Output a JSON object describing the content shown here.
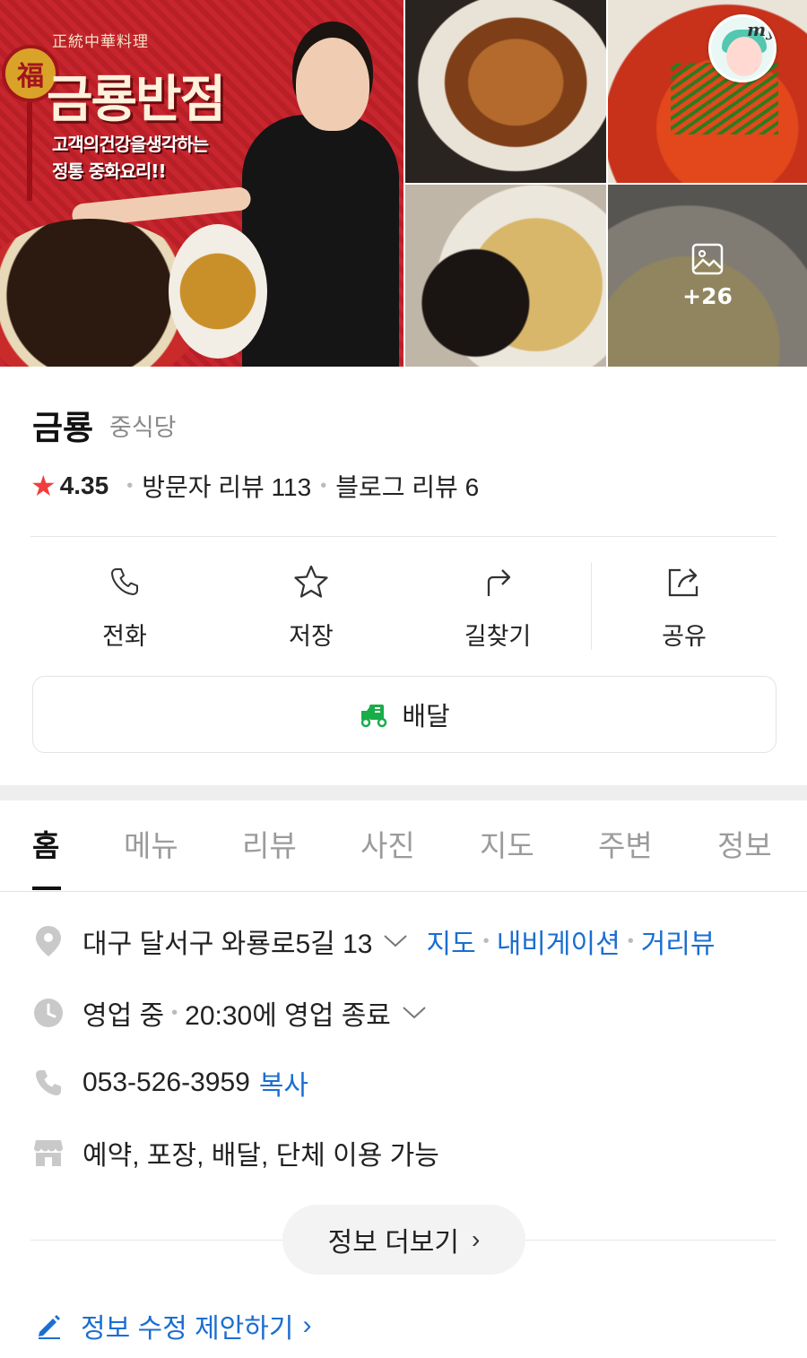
{
  "gallery": {
    "banner_subtitle": "正統中華料理",
    "banner_brand": "금룡반점",
    "banner_slogan_line1": "고객의건강을생각하는",
    "banner_slogan_line2": "정통 중화요리!!",
    "banner_char": "福",
    "more_count": "+26",
    "my_badge": "my"
  },
  "place": {
    "name": "금룡",
    "category": "중식당",
    "rating": "4.35",
    "visitor_reviews": "방문자 리뷰 113",
    "blog_reviews": "블로그 리뷰 6"
  },
  "actions": [
    {
      "label": "전화",
      "icon": "phone-icon"
    },
    {
      "label": "저장",
      "icon": "star-icon"
    },
    {
      "label": "길찾기",
      "icon": "directions-icon"
    },
    {
      "label": "공유",
      "icon": "share-icon"
    }
  ],
  "delivery": {
    "label": "배달",
    "icon": "delivery-truck-icon",
    "color": "#19ad4a"
  },
  "tabs": [
    "홈",
    "메뉴",
    "리뷰",
    "사진",
    "지도",
    "주변",
    "정보"
  ],
  "info": {
    "address": "대구 달서구 와룡로5길 13",
    "address_links": [
      "지도",
      "내비게이션",
      "거리뷰"
    ],
    "status": "영업 중",
    "hours": "20:30에 영업 종료",
    "phone": "053-526-3959",
    "copy_label": "복사",
    "services": "예약, 포장, 배달, 단체 이용 가능"
  },
  "more_info_label": "정보 더보기",
  "suggest_label": "정보 수정 제안하기",
  "colors": {
    "link": "#1b6ed1",
    "star": "#f23d3d",
    "accent_green": "#19ad4a"
  }
}
